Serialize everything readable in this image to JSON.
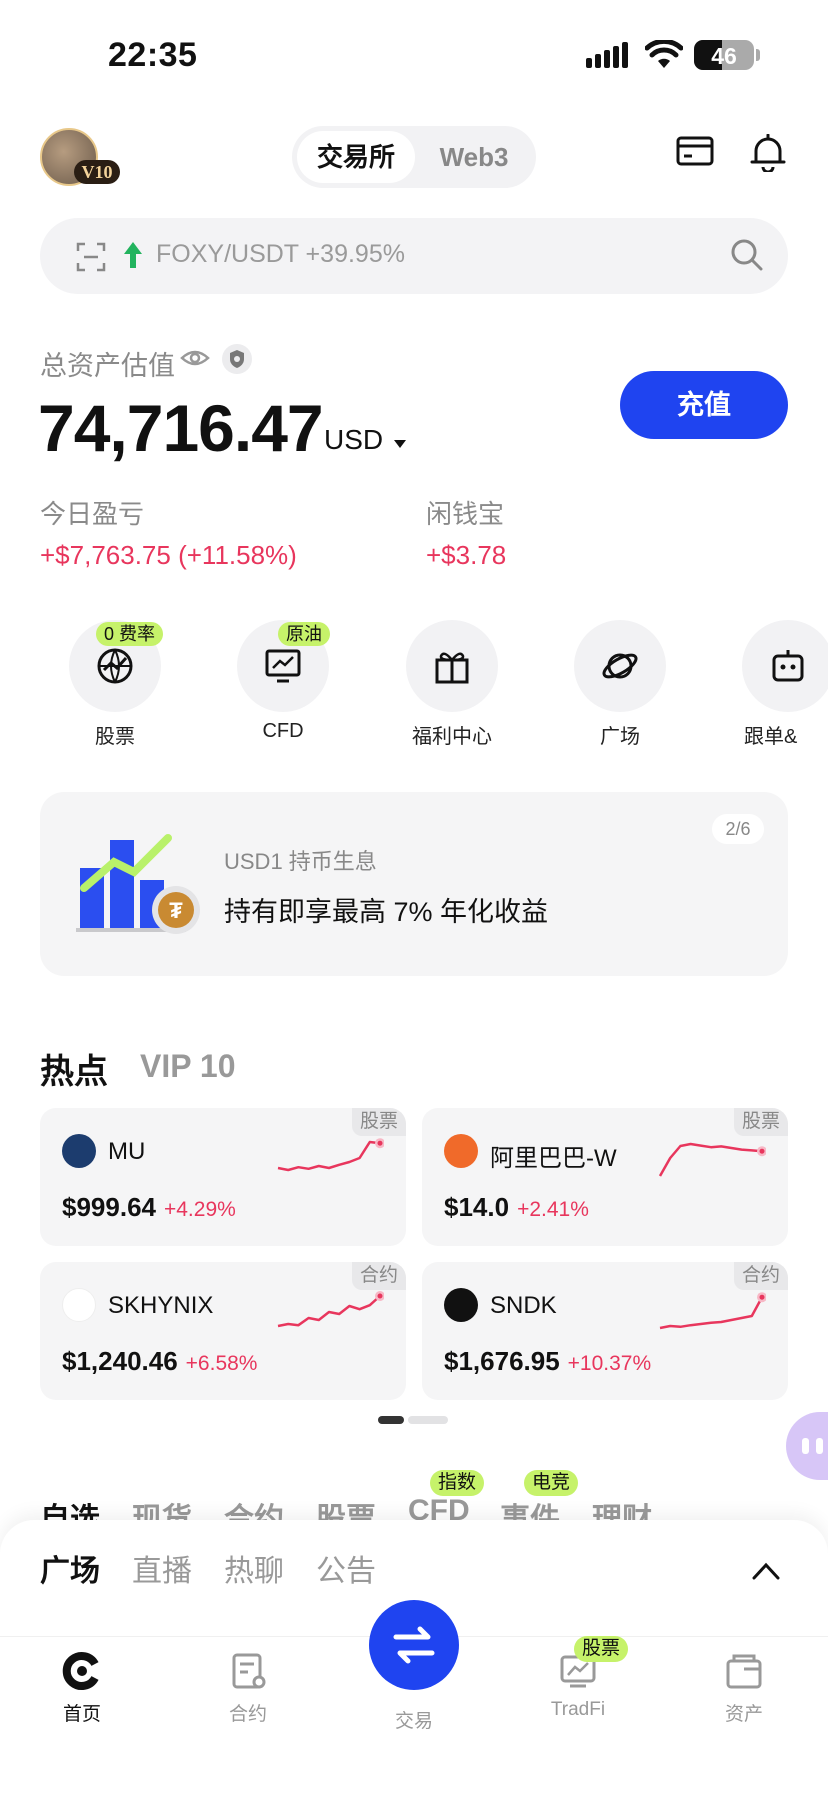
{
  "status_bar": {
    "time": "22:35",
    "battery": "46",
    "battery_level": 0.46
  },
  "header": {
    "vip_badge": "V10",
    "tabs": [
      "交易所",
      "Web3"
    ],
    "active_tab": "交易所"
  },
  "search": {
    "placeholder": "FOXY/USDT +39.95%"
  },
  "assets": {
    "label": "总资产估值",
    "total": "74,716.47",
    "currency": "USD",
    "deposit_label": "充值",
    "today_pnl_label": "今日盈亏",
    "today_pnl_value": "+$7,763.75 (+11.58%)",
    "idle_label": "闲钱宝",
    "idle_value": "+$3.78"
  },
  "quick_actions": [
    {
      "label": "股票",
      "tag": "0 费率",
      "icon": "globe-chart-icon"
    },
    {
      "label": "CFD",
      "tag": "原油",
      "icon": "monitor-chart-icon"
    },
    {
      "label": "福利中心",
      "tag": "",
      "icon": "gift-icon"
    },
    {
      "label": "广场",
      "tag": "",
      "icon": "planet-icon"
    },
    {
      "label": "跟单&",
      "tag": "",
      "icon": "robot-icon"
    }
  ],
  "banner": {
    "subtitle": "USD1 持币生息",
    "title": "持有即享最高 7% 年化收益",
    "page": "2/6"
  },
  "hot": {
    "title": "热点",
    "vip": "VIP 10",
    "cards": [
      {
        "name": "MU",
        "price": "$999.64",
        "change": "+4.29%",
        "tag": "股票",
        "logo_color": "#1c3c6e",
        "spark": [
          0.3,
          0.25,
          0.32,
          0.28,
          0.35,
          0.3,
          0.38,
          0.45,
          0.55,
          0.95,
          0.92
        ]
      },
      {
        "name": "阿里巴巴-W",
        "price": "$14.0",
        "change": "+2.41%",
        "tag": "股票",
        "logo_color": "#f06a2a",
        "spark": [
          0.1,
          0.55,
          0.85,
          0.9,
          0.86,
          0.82,
          0.84,
          0.8,
          0.76,
          0.74,
          0.72
        ]
      },
      {
        "name": "SKHYNIX",
        "price": "$1,240.46",
        "change": "+6.58%",
        "tag": "合约",
        "logo_color": "#ffffff",
        "spark": [
          0.2,
          0.25,
          0.22,
          0.4,
          0.35,
          0.55,
          0.5,
          0.7,
          0.62,
          0.72,
          0.95
        ]
      },
      {
        "name": "SNDK",
        "price": "$1,676.95",
        "change": "+10.37%",
        "tag": "合约",
        "logo_color": "#111111",
        "spark": [
          0.15,
          0.2,
          0.18,
          0.22,
          0.25,
          0.28,
          0.3,
          0.35,
          0.4,
          0.45,
          0.92
        ]
      }
    ]
  },
  "categories": [
    {
      "label": "自选",
      "tag": ""
    },
    {
      "label": "现货",
      "tag": ""
    },
    {
      "label": "合约",
      "tag": ""
    },
    {
      "label": "股票",
      "tag": ""
    },
    {
      "label": "CFD",
      "tag": "指数"
    },
    {
      "label": "事件",
      "tag": "电竞"
    },
    {
      "label": "理财",
      "tag": ""
    }
  ],
  "sheet_tabs": [
    "广场",
    "直播",
    "热聊",
    "公告"
  ],
  "tabbar": {
    "home": "首页",
    "contract": "合约",
    "trade": "交易",
    "tradfi": "TradFi",
    "tradfi_tag": "股票",
    "assets": "资产"
  },
  "colors": {
    "accent": "#1f44f0",
    "up": "#e8365d",
    "tag_green": "#c6f26a"
  }
}
